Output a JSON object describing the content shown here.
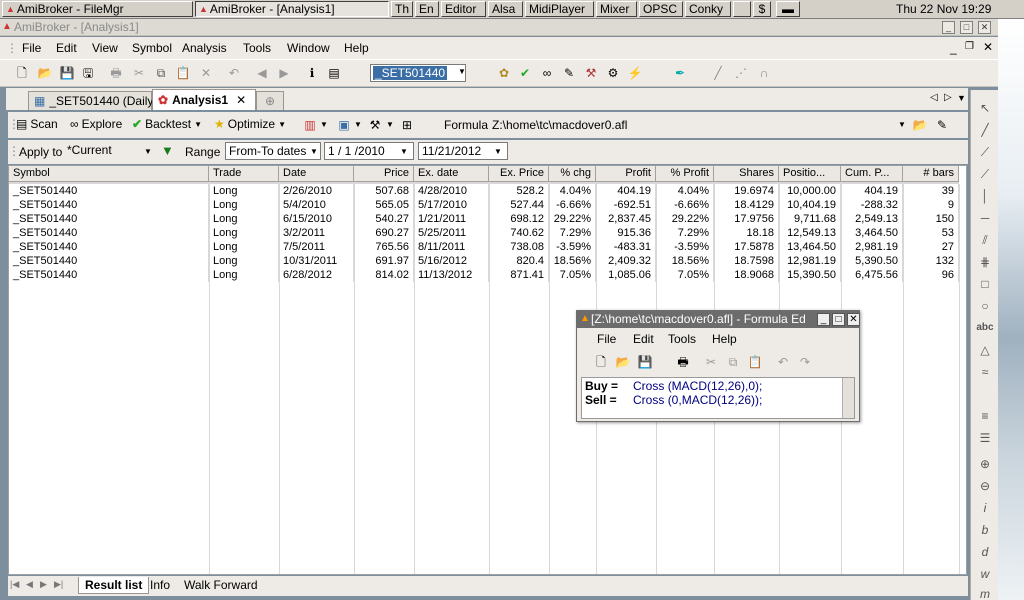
{
  "taskbar": {
    "items": [
      {
        "label": "AmiBroker - FileMgr"
      },
      {
        "label": "AmiBroker - [Analysis1]"
      },
      {
        "label": "Th"
      },
      {
        "label": "En"
      },
      {
        "label": "Editor"
      },
      {
        "label": "Alsa"
      },
      {
        "label": "MidiPlayer"
      },
      {
        "label": "Mixer"
      },
      {
        "label": "OPSC"
      },
      {
        "label": "Conky"
      },
      {
        "label": "$"
      }
    ],
    "clock": "Thu 22 Nov 19:29"
  },
  "window": {
    "title": "AmiBroker - [Analysis1]"
  },
  "menu": [
    "File",
    "Edit",
    "View",
    "Symbol",
    "Analysis",
    "Tools",
    "Window",
    "Help"
  ],
  "symbol_combo": "_SET501440",
  "tabs": [
    {
      "label": "_SET501440 (Daily"
    },
    {
      "label": "Analysis1"
    }
  ],
  "analysis_toolbar": {
    "scan": "Scan",
    "explore": "Explore",
    "backtest": "Backtest",
    "optimize": "Optimize",
    "formula_label": "Formula",
    "formula_path": "Z:\\home\\tc\\macdover0.afl"
  },
  "range_bar": {
    "apply_to_label": "Apply to",
    "apply_to_value": "*Current",
    "range_label": "Range",
    "range_value": "From-To dates",
    "from_date": "1 / 1 /2010",
    "to_date": "11/21/2012"
  },
  "columns": [
    "Symbol",
    "Trade",
    "Date",
    "Price",
    "Ex. date",
    "Ex. Price",
    "% chg",
    "Profit",
    "% Profit",
    "Shares",
    "Positio...",
    "Cum. P...",
    "# bars"
  ],
  "rows": [
    [
      "_SET501440",
      "Long",
      "2/26/2010",
      "507.68",
      "4/28/2010",
      "528.2",
      "4.04%",
      "404.19",
      "4.04%",
      "19.6974",
      "10,000.00",
      "404.19",
      "39"
    ],
    [
      "_SET501440",
      "Long",
      "5/4/2010",
      "565.05",
      "5/17/2010",
      "527.44",
      "-6.66%",
      "-692.51",
      "-6.66%",
      "18.4129",
      "10,404.19",
      "-288.32",
      "9"
    ],
    [
      "_SET501440",
      "Long",
      "6/15/2010",
      "540.27",
      "1/21/2011",
      "698.12",
      "29.22%",
      "2,837.45",
      "29.22%",
      "17.9756",
      "9,711.68",
      "2,549.13",
      "150"
    ],
    [
      "_SET501440",
      "Long",
      "3/2/2011",
      "690.27",
      "5/25/2011",
      "740.62",
      "7.29%",
      "915.36",
      "7.29%",
      "18.18",
      "12,549.13",
      "3,464.50",
      "53"
    ],
    [
      "_SET501440",
      "Long",
      "7/5/2011",
      "765.56",
      "8/11/2011",
      "738.08",
      "-3.59%",
      "-483.31",
      "-3.59%",
      "17.5878",
      "13,464.50",
      "2,981.19",
      "27"
    ],
    [
      "_SET501440",
      "Long",
      "10/31/2011",
      "691.97",
      "5/16/2012",
      "820.4",
      "18.56%",
      "2,409.32",
      "18.56%",
      "18.7598",
      "12,981.19",
      "5,390.50",
      "132"
    ],
    [
      "_SET501440",
      "Long",
      "6/28/2012",
      "814.02",
      "11/13/2012",
      "871.41",
      "7.05%",
      "1,085.06",
      "7.05%",
      "18.9068",
      "15,390.50",
      "6,475.56",
      "96"
    ]
  ],
  "bottom_tabs": [
    "Result list",
    "Info",
    "Walk Forward"
  ],
  "formula_editor": {
    "title": "[Z:\\home\\tc\\macdover0.afl] - Formula Ed",
    "menu": [
      "File",
      "Edit",
      "Tools",
      "Help"
    ],
    "code": [
      {
        "var": "Buy =",
        "func": "Cross",
        "args": "(MACD(12,26),0);"
      },
      {
        "var": "Sell =",
        "func": "Cross",
        "args": "(0,MACD(12,26));"
      }
    ]
  }
}
